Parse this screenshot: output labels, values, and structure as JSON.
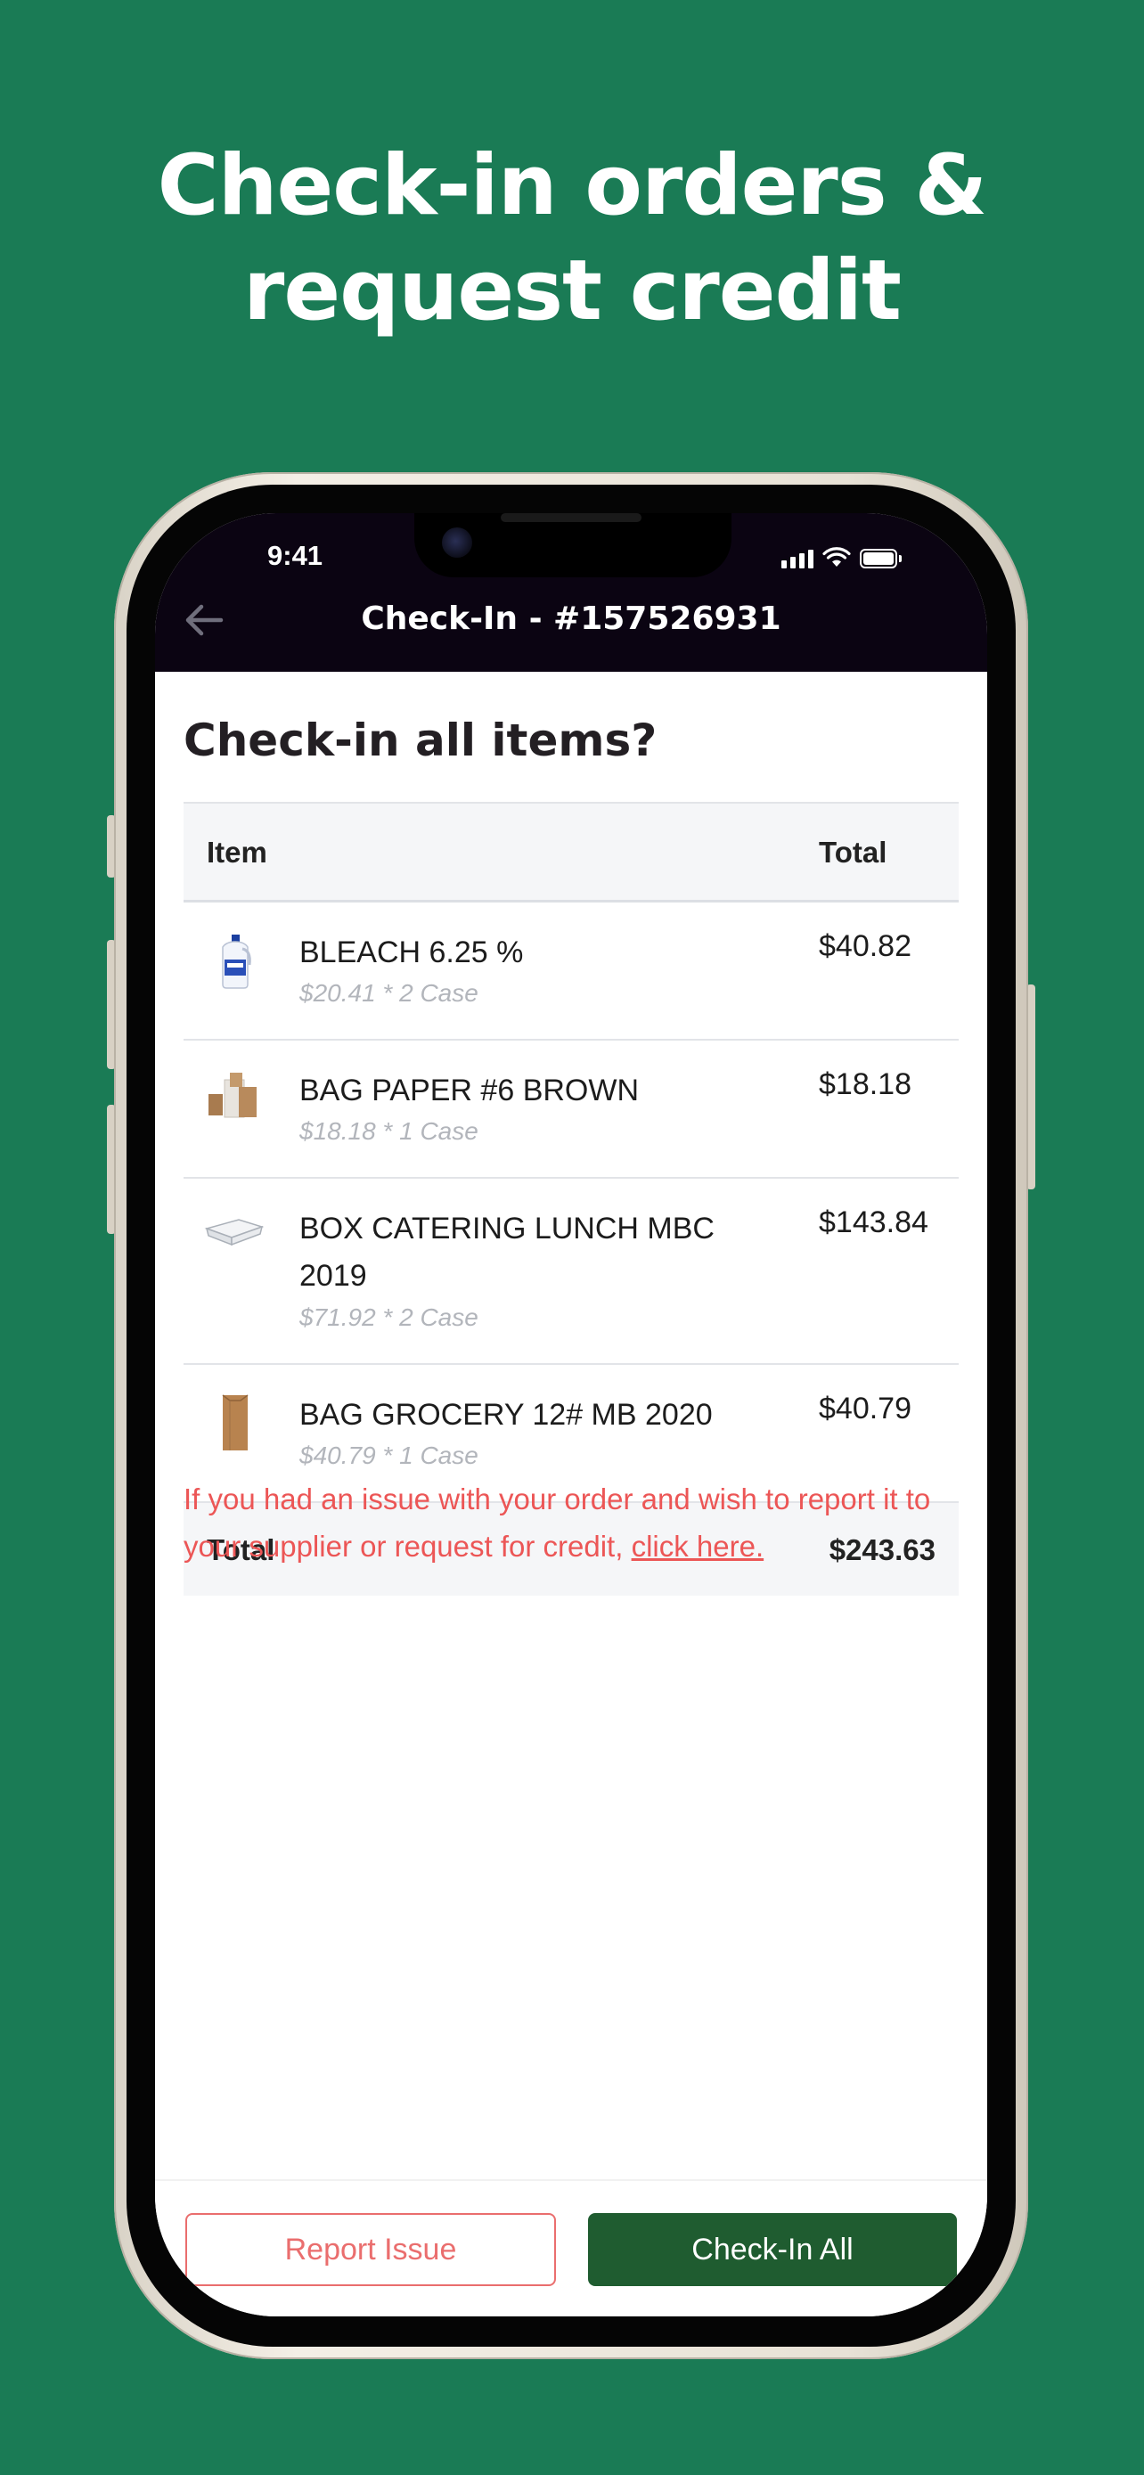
{
  "headline": {
    "line1": "Check-in orders &",
    "line2": "request credit"
  },
  "status_bar": {
    "time": "9:41",
    "icons": [
      "signal-icon",
      "wifi-icon",
      "battery-icon"
    ]
  },
  "nav": {
    "back_icon": "back-arrow-icon",
    "title": "Check-In - #157526931"
  },
  "page": {
    "title": "Check-in all items?"
  },
  "table": {
    "headers": {
      "item": "Item",
      "total": "Total"
    },
    "rows": [
      {
        "name": "BLEACH 6.25 %",
        "detail": "$20.41 * 2 Case",
        "total": "$40.82",
        "icon": "bleach-bottle-image"
      },
      {
        "name": "BAG PAPER #6 BROWN",
        "detail": "$18.18 * 1 Case",
        "total": "$18.18",
        "icon": "paper-bags-image"
      },
      {
        "name": "BOX CATERING LUNCH MBC 2019",
        "detail": "$71.92 * 2 Case",
        "total": "$143.84",
        "icon": "catering-box-image"
      },
      {
        "name": "BAG GROCERY 12# MB 2020",
        "detail": "$40.79 * 1 Case",
        "total": "$40.79",
        "icon": "grocery-bag-image"
      }
    ],
    "footer": {
      "label": "Total",
      "value": "$243.63"
    }
  },
  "notice": {
    "text": "If you had an issue with your order and wish to report it to your supplier or request for credit, ",
    "link": "click here."
  },
  "actions": {
    "report_label": "Report Issue",
    "checkin_label": "Check-In All"
  },
  "colors": {
    "background": "#1a7b55",
    "header": "#0b0412",
    "accent_red": "#ec5656",
    "primary_green": "#1f5c30"
  }
}
